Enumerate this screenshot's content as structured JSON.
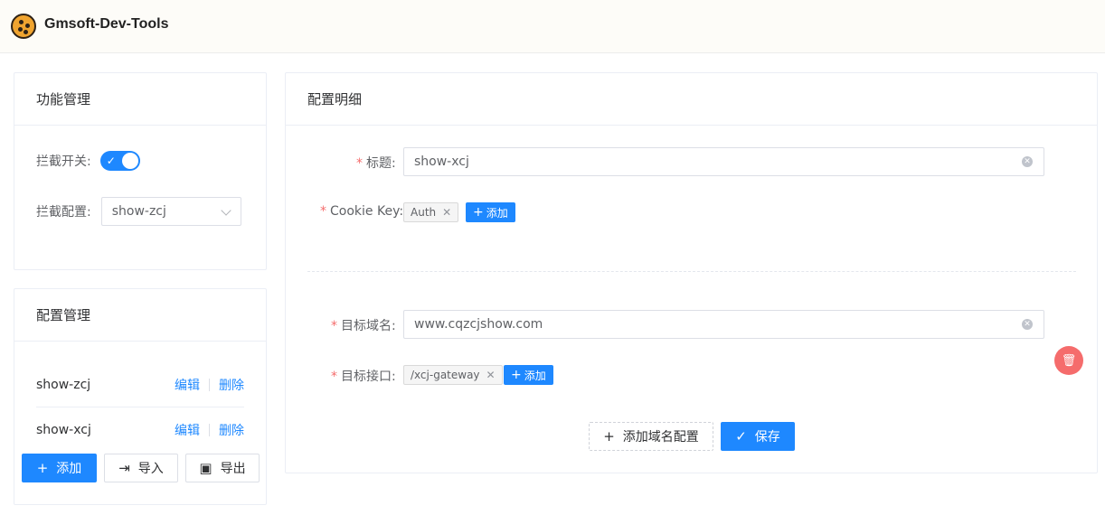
{
  "app": {
    "title": "Gmsoft-Dev-Tools"
  },
  "func_card": {
    "title": "功能管理",
    "switch_label": "拦截开关:",
    "switch_on": true,
    "config_label": "拦截配置:",
    "config_value": "show-zcj"
  },
  "cfg_card": {
    "title": "配置管理",
    "items": [
      {
        "name": "show-zcj",
        "edit": "编辑",
        "delete": "删除"
      },
      {
        "name": "show-xcj",
        "edit": "编辑",
        "delete": "删除"
      }
    ],
    "add": "添加",
    "import": "导入",
    "export": "导出"
  },
  "detail": {
    "title": "配置明细",
    "title_label": "标题:",
    "title_value": "show-xcj",
    "cookie_label": "Cookie Key:",
    "cookie_tags": [
      "Auth"
    ],
    "add_label": "添加",
    "domain_label": "目标域名:",
    "domain_value": "www.cqzcjshow.com",
    "api_label": "目标接口:",
    "api_tags": [
      "/xcj-gateway"
    ],
    "add_domain": "添加域名配置",
    "save": "保存"
  },
  "colors": {
    "primary": "#1e88ff",
    "danger": "#f56c6c",
    "required": "#f56c6c"
  }
}
